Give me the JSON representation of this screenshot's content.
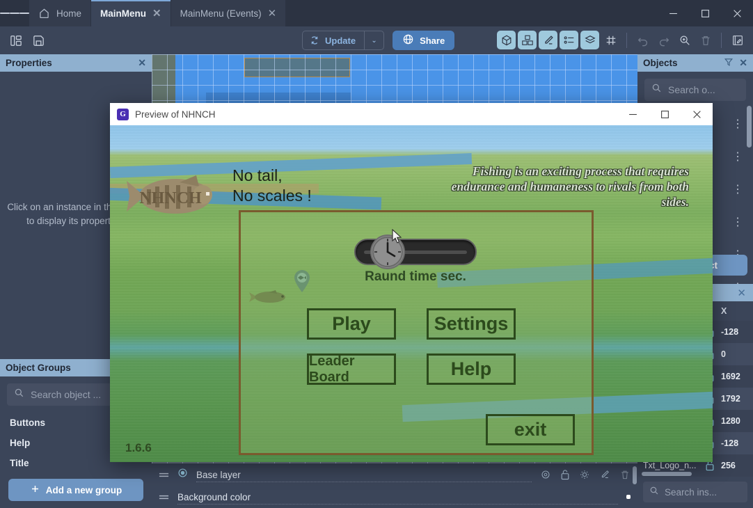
{
  "window": {
    "minimize": "—",
    "maximize": "▢",
    "close": "✕"
  },
  "tabs": {
    "menu_icon": "hamburger-icon",
    "items": [
      {
        "label": "Home",
        "icon": "home-icon",
        "active": false,
        "closable": false
      },
      {
        "label": "MainMenu",
        "icon": "",
        "active": true,
        "closable": true
      },
      {
        "label": "MainMenu (Events)",
        "icon": "",
        "active": false,
        "closable": true
      }
    ],
    "close_glyph": "✕"
  },
  "toolbar": {
    "left_icons": [
      {
        "name": "scene-layout-icon"
      },
      {
        "name": "save-icon"
      }
    ],
    "update_label": "Update",
    "update_icon": "refresh-icon",
    "update_caret": "⌄",
    "share_label": "Share",
    "share_icon": "globe-icon",
    "right_icons": [
      {
        "name": "object-3d-icon",
        "state": "on"
      },
      {
        "name": "objects-group-icon",
        "state": "on"
      },
      {
        "name": "edit-pencil-icon",
        "state": "on"
      },
      {
        "name": "properties-list-icon",
        "state": "on"
      },
      {
        "name": "layers-icon",
        "state": "on"
      },
      {
        "name": "grid-icon",
        "state": "off"
      },
      {
        "name": "undo-icon",
        "state": "dim"
      },
      {
        "name": "redo-icon",
        "state": "dim"
      },
      {
        "name": "zoom-in-icon",
        "state": "off"
      },
      {
        "name": "trash-icon",
        "state": "dim"
      },
      {
        "name": "open-events-icon",
        "state": "off"
      }
    ]
  },
  "properties_panel": {
    "title": "Properties",
    "close_glyph": "✕",
    "empty_message": "Click on an instance in the scene to display its properties."
  },
  "object_groups_panel": {
    "title": "Object Groups",
    "search_placeholder": "Search object ...",
    "groups": [
      "Buttons",
      "Help",
      "Title"
    ],
    "add_button": "Add a new group",
    "add_icon": "plus-icon"
  },
  "objects_panel": {
    "title": "Objects",
    "filter_icon": "filter-icon",
    "close_glyph": "✕",
    "search_placeholder": "Search o...",
    "rows": [
      {
        "trunc": "",
        "menu": "⋮"
      },
      {
        "trunc": "",
        "menu": "⋮"
      },
      {
        "trunc": "...",
        "menu": "⋮"
      },
      {
        "trunc": "..",
        "menu": "⋮"
      },
      {
        "trunc": "...",
        "menu": "⋮"
      },
      {
        "trunc": "",
        "menu": "⋮"
      }
    ],
    "add_object_label": "w object"
  },
  "instances_panel": {
    "close_glyph": "✕",
    "columns": [
      "",
      "",
      "X"
    ],
    "rows": [
      {
        "name": "",
        "lock": "unlock-icon",
        "x": "-128"
      },
      {
        "name": "",
        "lock": "unlock-icon",
        "x": "0"
      },
      {
        "name": "",
        "lock": "unlock-icon",
        "x": "1692"
      },
      {
        "name": "",
        "lock": "unlock-icon",
        "x": "1792"
      },
      {
        "name": "",
        "lock": "unlock-icon",
        "x": "1280"
      },
      {
        "name": "",
        "lock": "unlock-icon",
        "x": "-128"
      },
      {
        "name": "Txt_Logo_n...",
        "lock": "unlock-icon",
        "x": "256"
      }
    ],
    "search_placeholder": "Search ins..."
  },
  "layers_panel": {
    "rows": [
      {
        "name": "Base layer",
        "type": "layer",
        "drag_icon": "drag-handle-icon",
        "visible_icon": "eye-icon",
        "lock_icon": "unlock-icon",
        "effects_icon": "lighting-icon",
        "edit_icon": "pencil-icon",
        "delete_icon": "trash-icon"
      },
      {
        "name": "Background color",
        "type": "background",
        "drag_icon": "drag-handle-icon",
        "color": "#4a94e8"
      }
    ]
  },
  "preview_window": {
    "title": "Preview of NHNCH",
    "app_icon": "gdevelop-logo-icon",
    "minimize": "—",
    "maximize": "▢",
    "close": "✕"
  },
  "game": {
    "headline": "No tail,\nNo scales !",
    "tagline": "Fishing is an exciting process that requires endurance and humaneness to rivals from both sides.",
    "logo_text": "NHNCH",
    "version": "1.6.6",
    "slider": {
      "label": "Raund time sec.",
      "knob_icon": "clock-icon"
    },
    "buttons": [
      {
        "key": "play",
        "label": "Play"
      },
      {
        "key": "settings",
        "label": "Settings"
      },
      {
        "key": "leader",
        "label": "Leader Board"
      },
      {
        "key": "help",
        "label": "Help"
      },
      {
        "key": "exit",
        "label": "exit"
      }
    ],
    "pin_icon": "map-pin-fish-icon",
    "fish_icon": "fish-sprite-icon"
  },
  "cursor": {
    "icon": "mouse-pointer-icon"
  },
  "colors": {
    "accent_blue": "#6e95c2",
    "panel_head": "#8fb0cf",
    "bg_dark": "#3b4559",
    "tab_active": "#3b4559",
    "grid_blue": "#4a94e8",
    "game_button_border": "#2c4a1c"
  }
}
